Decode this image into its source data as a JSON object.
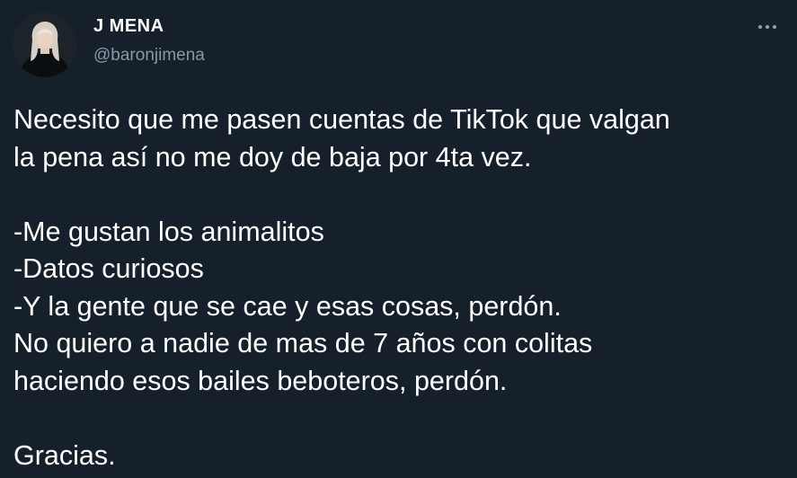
{
  "author": {
    "display_name": "J MENA",
    "handle": "@baronjimena",
    "avatar_icon": "user-avatar-photo"
  },
  "menu": {
    "more_icon": "more-horizontal-icon"
  },
  "tweet": {
    "lines": [
      "Necesito que me pasen cuentas de TikTok que valgan",
      "la pena así no me doy de baja por 4ta vez.",
      "",
      "-Me gustan los animalitos",
      "-Datos curiosos",
      "-Y la gente que se cae y esas cosas, perdón.",
      "No quiero a nadie de mas de 7 años con colitas",
      "haciendo esos bailes beboteros, perdón.",
      "",
      "Gracias."
    ]
  },
  "colors": {
    "background": "#15202b",
    "text": "#ffffff",
    "secondary_text": "#8b98a5"
  }
}
